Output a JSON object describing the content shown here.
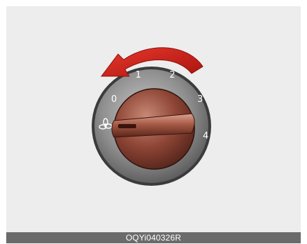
{
  "figure": {
    "caption": "OQYi040326R",
    "control": "fan-speed-knob",
    "dial_labels": [
      "0",
      "1",
      "2",
      "3",
      "4"
    ],
    "fan_symbol": "fan-icon",
    "rotation_arrow": "counterclockwise-arrow-icon"
  },
  "colors": {
    "panel_background": "#ededed",
    "arrow": "#d6281f",
    "knob": "#9a4a38",
    "caption_bar": "#6b6b6b"
  }
}
